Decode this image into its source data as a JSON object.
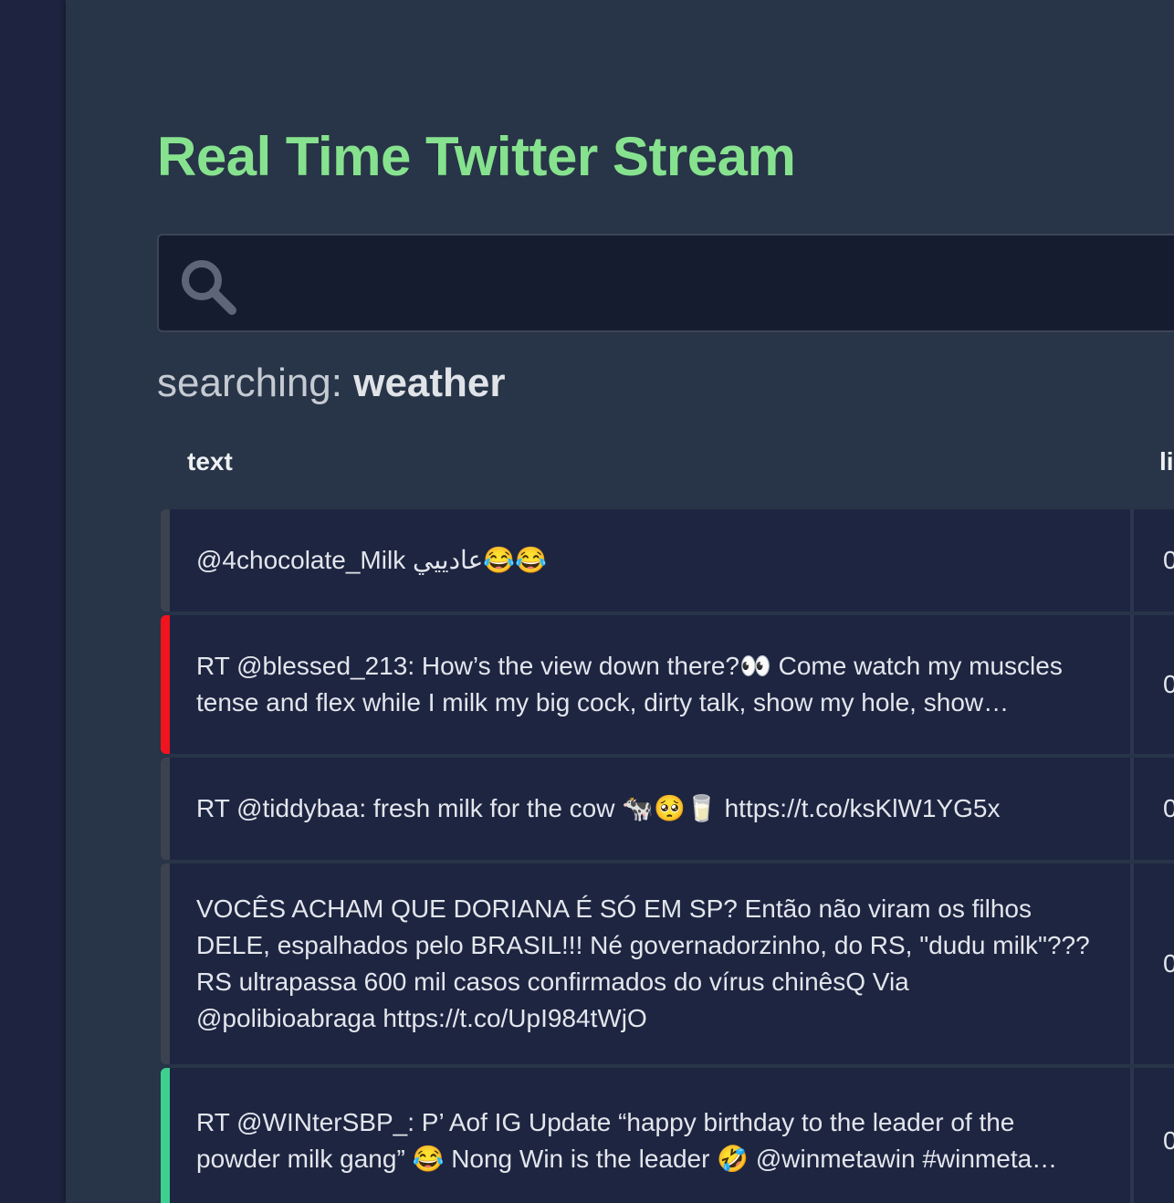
{
  "header": {
    "title": "Real Time Twitter Stream"
  },
  "search": {
    "value": "",
    "placeholder": "",
    "icon": "search-icon",
    "status_prefix": "searching: ",
    "status_term": "weather"
  },
  "table": {
    "columns": [
      "text",
      "li"
    ],
    "rows": [
      {
        "text": "@4chocolate_Milk عادييي😂😂",
        "likes": "0",
        "accent": "neutral"
      },
      {
        "text": "RT @blessed_213: How’s the view down there?👀 Come watch my muscles tense and flex while I milk my big cock, dirty talk, show my hole, show…",
        "likes": "0",
        "accent": "red"
      },
      {
        "text": "RT @tiddybaa: fresh milk for the cow 🐄🥺🥛 https://t.co/ksKlW1YG5x",
        "likes": "0",
        "accent": "neutral"
      },
      {
        "text": "VOCÊS ACHAM QUE DORIANA É SÓ EM SP? Então não viram os filhos DELE, espalhados pelo BRASIL!!! Né governadorzinho, do RS, \"dudu milk\"??? RS ultrapassa 600 mil casos confirmados do vírus chinêsQ Via @polibioabraga https://t.co/UpI984tWjO",
        "likes": "0",
        "accent": "neutral"
      },
      {
        "text": "RT @WINterSBP_: P’ Aof IG Update “happy birthday to the leader of the powder milk gang” 😂 Nong Win is the leader 🤣 @winmetawin #winmeta…",
        "likes": "0",
        "accent": "green"
      }
    ]
  },
  "colors": {
    "background": "#1e2440",
    "panel": "#283447",
    "title": "#86e28e",
    "row_background": "#1e2541",
    "accent_neutral": "#3d4250",
    "accent_red": "#f0141e",
    "accent_green": "#3fcf8e"
  }
}
